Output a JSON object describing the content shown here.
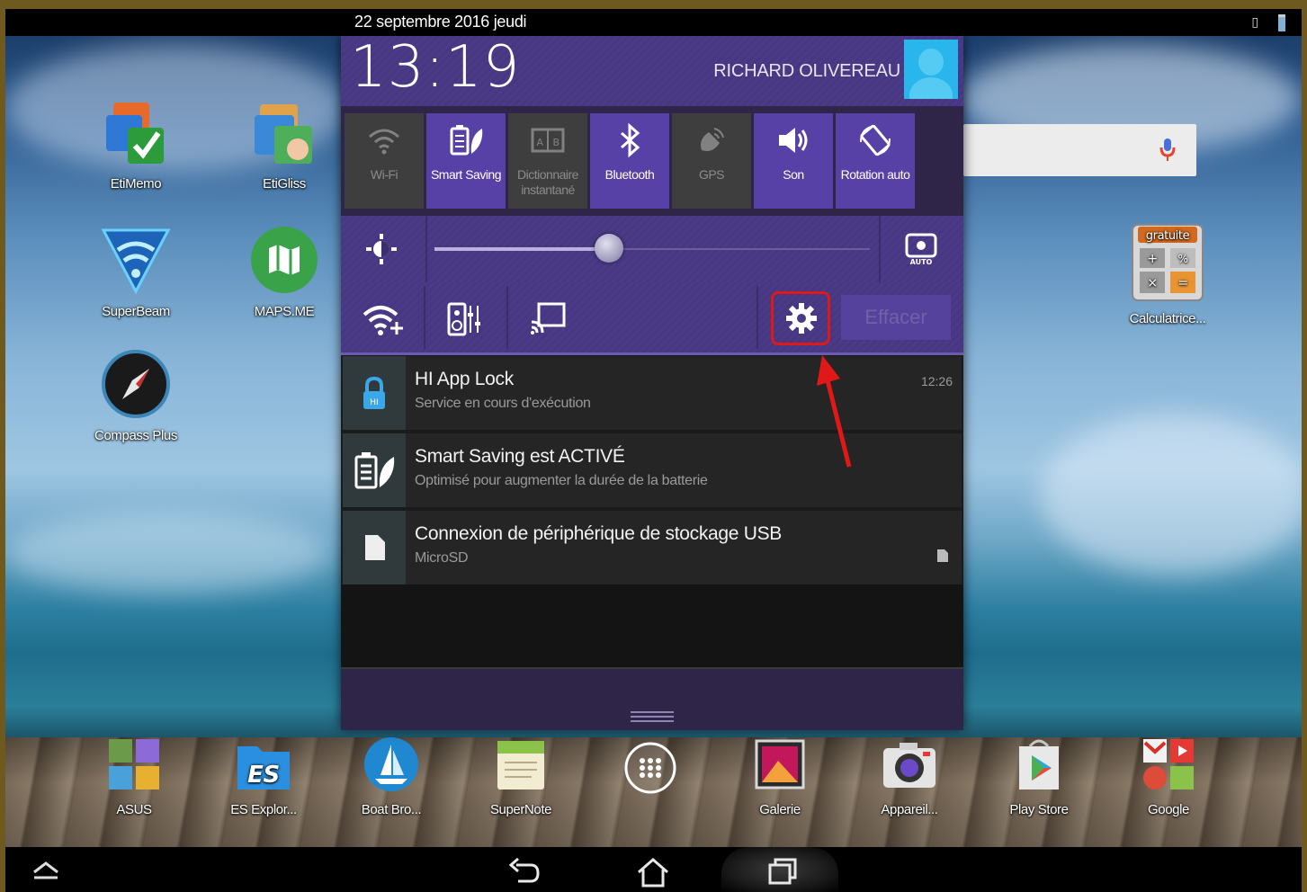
{
  "status_bar": {
    "date": "22 septembre 2016 jeudi"
  },
  "shade": {
    "clock": "13:19",
    "user_name": "RICHARD OLIVEREAU",
    "quick_tiles": [
      {
        "label": "Wi-Fi",
        "state": "off",
        "icon": "wifi-icon"
      },
      {
        "label": "Smart Saving",
        "state": "on",
        "icon": "battery-leaf-icon"
      },
      {
        "label": "Dictionnaire instantané",
        "state": "off",
        "icon": "dictionary-icon"
      },
      {
        "label": "Bluetooth",
        "state": "on",
        "icon": "bluetooth-icon"
      },
      {
        "label": "GPS",
        "state": "off",
        "icon": "gps-icon"
      },
      {
        "label": "Son",
        "state": "on",
        "icon": "sound-icon"
      },
      {
        "label": "Rotation auto",
        "state": "on",
        "icon": "rotation-icon"
      }
    ],
    "brightness_level": 0.4,
    "brightness_auto_label": "AUTO",
    "clear_button": "Effacer",
    "notifications": [
      {
        "title": "HI App Lock",
        "text": "Service en cours d'exécution",
        "time": "12:26",
        "icon": "lock-icon"
      },
      {
        "title": "Smart Saving est ACTIVÉ",
        "text": "Optimisé pour augmenter la durée de la batterie",
        "icon": "battery-leaf-icon"
      },
      {
        "title": "Connexion de périphérique de stockage USB",
        "text": "MicroSD",
        "icon": "sd-card-icon"
      }
    ]
  },
  "desktop": {
    "icons": [
      {
        "label": "EtiMemo"
      },
      {
        "label": "EtiGliss"
      },
      {
        "label": "SuperBeam"
      },
      {
        "label": "MAPS.ME"
      },
      {
        "label": "Compass Plus"
      },
      {
        "label": "Calculatrice..."
      }
    ],
    "calculator_badge": "gratuite"
  },
  "dock": [
    {
      "label": "ASUS"
    },
    {
      "label": "ES Explor..."
    },
    {
      "label": "Boat Bro..."
    },
    {
      "label": "SuperNote"
    },
    {
      "label": ""
    },
    {
      "label": "Galerie"
    },
    {
      "label": "Appareil..."
    },
    {
      "label": "Play Store"
    },
    {
      "label": "Google"
    }
  ],
  "colors": {
    "accent_purple": "#5740a6",
    "highlight_red": "#e01818",
    "search_mic": "#e8452f"
  }
}
